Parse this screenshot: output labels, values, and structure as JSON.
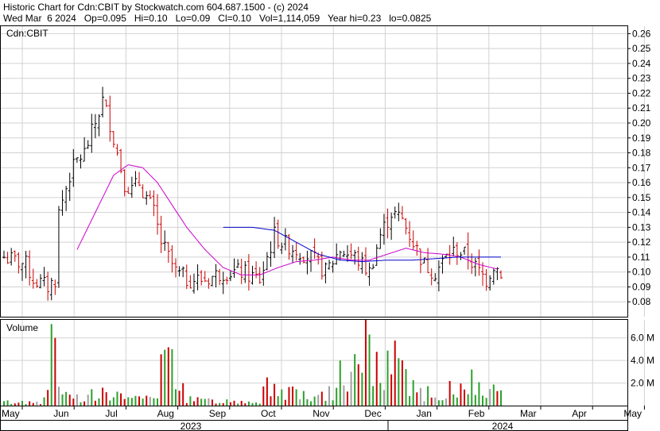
{
  "header": {
    "line1": "Historic Chart for Cdn:CBIT by Stockwatch.com 604.687.1500 - (c) 2024",
    "line2": "Wed Mar  6 2024   Op=0.095   Hi=0.10   Lo=0.09   Cl=0.10   Vol=1,114,059   Year hi=0.23   lo=0.0825"
  },
  "chart_data": {
    "type": "ohlc",
    "ticker_label": "Cdn:CBIT",
    "volume_label": "Volume",
    "price_ticks": [
      "0.26",
      "0.25",
      "0.24",
      "0.23",
      "0.22",
      "0.21",
      "0.20",
      "0.19",
      "0.18",
      "0.17",
      "0.16",
      "0.15",
      "0.14",
      "0.13",
      "0.12",
      "0.11",
      "0.10",
      "0.09",
      "0.08"
    ],
    "price_range": [
      0.07,
      0.265
    ],
    "volume_ticks": [
      "6.0 M",
      "4.0 M",
      "2.0 M"
    ],
    "volume_range": [
      0,
      7.6
    ],
    "month_labels": [
      "May",
      "Jun",
      "Jul",
      "Aug",
      "Sep",
      "Oct",
      "Nov",
      "Dec",
      "Jan",
      "Feb",
      "Mar",
      "Apr",
      "May"
    ],
    "year_labels": [
      "2023",
      "2024"
    ],
    "colors": {
      "up": "#000000",
      "down": "#cc0000",
      "vol_up": "#2ca02c",
      "vol_down": "#cc0000",
      "vol_flat": "#a0a0a0",
      "ma_short": "#cc00cc",
      "ma_long": "#0000cc",
      "grid": "#d2d2d2"
    },
    "price_path_keypoints": [
      [
        0,
        0.11
      ],
      [
        6,
        0.105
      ],
      [
        8,
        0.095
      ],
      [
        12,
        0.09
      ],
      [
        14,
        0.095
      ],
      [
        15,
        0.14
      ],
      [
        18,
        0.165
      ],
      [
        20,
        0.175
      ],
      [
        22,
        0.18
      ],
      [
        25,
        0.2
      ],
      [
        27,
        0.215
      ],
      [
        29,
        0.2
      ],
      [
        31,
        0.18
      ],
      [
        33,
        0.16
      ],
      [
        35,
        0.155
      ],
      [
        37,
        0.16
      ],
      [
        39,
        0.15
      ],
      [
        41,
        0.14
      ],
      [
        43,
        0.12
      ],
      [
        45,
        0.11
      ],
      [
        47,
        0.1
      ],
      [
        50,
        0.095
      ],
      [
        55,
        0.095
      ],
      [
        60,
        0.1
      ],
      [
        65,
        0.1
      ],
      [
        70,
        0.095
      ],
      [
        72,
        0.11
      ],
      [
        74,
        0.125
      ],
      [
        76,
        0.12
      ],
      [
        80,
        0.115
      ],
      [
        84,
        0.11
      ],
      [
        88,
        0.1
      ],
      [
        92,
        0.115
      ],
      [
        96,
        0.11
      ],
      [
        100,
        0.1
      ],
      [
        103,
        0.125
      ],
      [
        106,
        0.14
      ],
      [
        109,
        0.135
      ],
      [
        112,
        0.12
      ],
      [
        115,
        0.105
      ],
      [
        118,
        0.1
      ],
      [
        121,
        0.11
      ],
      [
        124,
        0.115
      ],
      [
        127,
        0.11
      ],
      [
        130,
        0.1
      ],
      [
        132,
        0.095
      ],
      [
        134,
        0.105
      ],
      [
        136,
        0.1
      ]
    ],
    "ma_short_path": [
      [
        20,
        0.115
      ],
      [
        25,
        0.14
      ],
      [
        30,
        0.165
      ],
      [
        34,
        0.172
      ],
      [
        38,
        0.17
      ],
      [
        42,
        0.16
      ],
      [
        46,
        0.145
      ],
      [
        50,
        0.13
      ],
      [
        55,
        0.115
      ],
      [
        60,
        0.103
      ],
      [
        65,
        0.098
      ],
      [
        70,
        0.098
      ],
      [
        75,
        0.103
      ],
      [
        80,
        0.107
      ],
      [
        85,
        0.108
      ],
      [
        90,
        0.11
      ],
      [
        95,
        0.108
      ],
      [
        100,
        0.108
      ],
      [
        105,
        0.112
      ],
      [
        110,
        0.116
      ],
      [
        115,
        0.113
      ],
      [
        120,
        0.112
      ],
      [
        125,
        0.11
      ],
      [
        130,
        0.105
      ],
      [
        135,
        0.102
      ]
    ],
    "ma_long_path": [
      [
        60,
        0.13
      ],
      [
        68,
        0.13
      ],
      [
        74,
        0.128
      ],
      [
        80,
        0.12
      ],
      [
        86,
        0.112
      ],
      [
        92,
        0.108
      ],
      [
        98,
        0.107
      ],
      [
        105,
        0.108
      ],
      [
        112,
        0.108
      ],
      [
        118,
        0.109
      ],
      [
        124,
        0.11
      ],
      [
        130,
        0.11
      ],
      [
        136,
        0.11
      ]
    ],
    "volume_keypoints": [
      [
        0,
        0.3
      ],
      [
        10,
        0.3
      ],
      [
        14,
        6.0
      ],
      [
        15,
        1.2
      ],
      [
        20,
        0.8
      ],
      [
        26,
        1.5
      ],
      [
        30,
        0.8
      ],
      [
        40,
        0.6
      ],
      [
        46,
        5.0
      ],
      [
        50,
        0.5
      ],
      [
        60,
        0.4
      ],
      [
        70,
        0.4
      ],
      [
        72,
        2.5
      ],
      [
        80,
        1.0
      ],
      [
        90,
        1.2
      ],
      [
        92,
        4.0
      ],
      [
        95,
        3.0
      ],
      [
        100,
        6.3
      ],
      [
        103,
        2.0
      ],
      [
        108,
        4.2
      ],
      [
        112,
        1.5
      ],
      [
        116,
        1.2
      ],
      [
        120,
        0.6
      ],
      [
        124,
        2.0
      ],
      [
        128,
        3.2
      ],
      [
        132,
        1.6
      ],
      [
        136,
        0.8
      ]
    ]
  }
}
